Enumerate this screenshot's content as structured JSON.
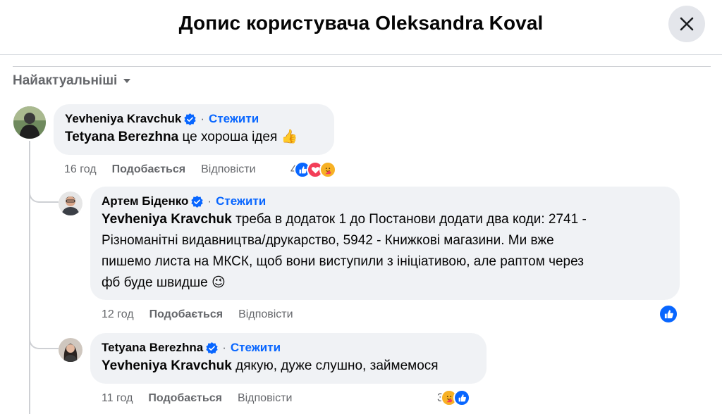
{
  "header": {
    "title": "Допис користувача Oleksandra Koval",
    "close_icon": "close-icon"
  },
  "sort": {
    "label": "Найактуальніші",
    "icon": "caret-down-icon"
  },
  "comments": [
    {
      "author": "Yevheniya Kravchuk",
      "verified": true,
      "follow_label": "Стежити",
      "mention": "Tetyana Berezhna",
      "text": " це хороша ідея 👍",
      "time": "16 год",
      "like_label": "Подобається",
      "reply_label": "Відповісти",
      "reaction_count": "4",
      "reactions": [
        "like",
        "love",
        "care"
      ]
    },
    {
      "author": "Артем Біденко",
      "verified": true,
      "follow_label": "Стежити",
      "mention": "Yevheniya Kravchuk",
      "text_lines": [
        " треба в додаток 1 до Постанови додати два коди: 2741 -",
        "Різноманітні видавництва/друкарство, 5942 - Книжкові магазини. Ми вже",
        "пишемо листа на МКСК, щоб вони виступили з ініціативою, але раптом через",
        "фб буде швидше 😉"
      ],
      "time": "12 год",
      "like_label": "Подобається",
      "reply_label": "Відповісти",
      "reaction_count": "",
      "reactions": [
        "like"
      ]
    },
    {
      "author": "Tetyana Berezhna",
      "verified": true,
      "follow_label": "Стежити",
      "mention": "Yevheniya Kravchuk",
      "text": " дякую, дуже слушно, займемося",
      "time": "11 год",
      "like_label": "Подобається",
      "reply_label": "Відповісти",
      "reaction_count": "3",
      "reactions": [
        "care",
        "like"
      ]
    }
  ],
  "colors": {
    "accent": "#0866ff",
    "bubble": "#f0f2f5",
    "muted": "#65676b",
    "love": "#f33e58",
    "care": "#f7b125"
  }
}
